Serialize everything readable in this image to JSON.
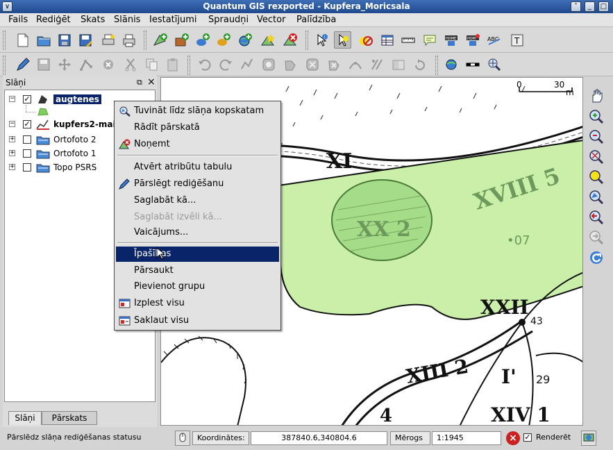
{
  "window": {
    "title": "Quantum GIS rexported - Kupfera_Moricsala",
    "sys_menu": "∨",
    "shade": "˄",
    "minimize": "_",
    "maximize": "□",
    "close": "×"
  },
  "menubar": {
    "items": [
      "Fails",
      "Rediģēt",
      "Skats",
      "Slānis",
      "Iestatījumi",
      "Spraudņi",
      "Vector",
      "Palīdzība"
    ]
  },
  "layers_panel": {
    "title": "Slāņi",
    "float_btn": "⧉",
    "close_btn": "×",
    "expand_open": "−",
    "expand_closed": "+",
    "check": "✓",
    "layers": [
      {
        "name": "augtenes",
        "checked": true,
        "expanded": true,
        "selected": true,
        "icon": "polygon-layer-icon"
      },
      {
        "name": "kupfers2-mai",
        "checked": true,
        "expanded": true,
        "selected": false,
        "icon": "line-layer-icon"
      },
      {
        "name": "Ortofoto 2",
        "checked": false,
        "expanded": false,
        "selected": false,
        "icon": "raster-layer-icon"
      },
      {
        "name": "Ortofoto 1",
        "checked": false,
        "expanded": false,
        "selected": false,
        "icon": "raster-layer-icon"
      },
      {
        "name": "Topo PSRS",
        "checked": false,
        "expanded": false,
        "selected": false,
        "icon": "raster-layer-icon"
      }
    ],
    "tabs": [
      "Slāņi",
      "Pārskats"
    ]
  },
  "context_menu": {
    "items": [
      {
        "label": "Tuvināt līdz slāņa kopskatam",
        "icon": "zoom-to-layer-icon",
        "disabled": false,
        "highlighted": false
      },
      {
        "label": "Rādīt pārskatā",
        "icon": "",
        "disabled": false,
        "highlighted": false
      },
      {
        "label": "Noņemt",
        "icon": "remove-layer-icon",
        "disabled": false,
        "highlighted": false
      },
      {
        "label": "Atvērt atribūtu tabulu",
        "icon": "",
        "disabled": false,
        "highlighted": false
      },
      {
        "label": "Pārslēgt rediģēšanu",
        "icon": "pencil-icon",
        "disabled": false,
        "highlighted": false
      },
      {
        "label": "Saglabāt kā...",
        "icon": "",
        "disabled": false,
        "highlighted": false
      },
      {
        "label": "Saglabāt izvēli kā...",
        "icon": "",
        "disabled": true,
        "highlighted": false
      },
      {
        "label": "Vaicājums...",
        "icon": "",
        "disabled": false,
        "highlighted": false
      },
      {
        "label": "Īpašības",
        "icon": "",
        "disabled": false,
        "highlighted": true
      },
      {
        "label": "Pārsaukt",
        "icon": "",
        "disabled": false,
        "highlighted": false
      },
      {
        "label": "Pievienot grupu",
        "icon": "",
        "disabled": false,
        "highlighted": false
      },
      {
        "label": "Izplest visu",
        "icon": "expand-all-icon",
        "disabled": false,
        "highlighted": false
      },
      {
        "label": "Saklaut visu",
        "icon": "collapse-all-icon",
        "disabled": false,
        "highlighted": false
      }
    ]
  },
  "map": {
    "scalebar_start": "0",
    "scalebar_end": "30",
    "scalebar_unit": "m",
    "labels": [
      "XI",
      "XX 2",
      "XVIII 5",
      "•07",
      "XXII",
      "43",
      "XIII 2",
      "I'",
      "29",
      "XIV 1",
      "4"
    ]
  },
  "statusbar": {
    "message": "Pārslēdz slāņa rediģēšanas statusu",
    "coords_label": "Koordinātes:",
    "coords_value": "387840.6,340804.6",
    "scale_label": "Mērogs",
    "scale_value": "1:1945",
    "render_label": "Renderēt",
    "render_checked": true
  },
  "colors": {
    "title_bar": "#2a5aa2",
    "selection": "#0a246a",
    "map_polygon_fill": "#c9efa9",
    "map_polygon_inner": "#a5dc88",
    "stop_red": "#cc1f1f"
  }
}
